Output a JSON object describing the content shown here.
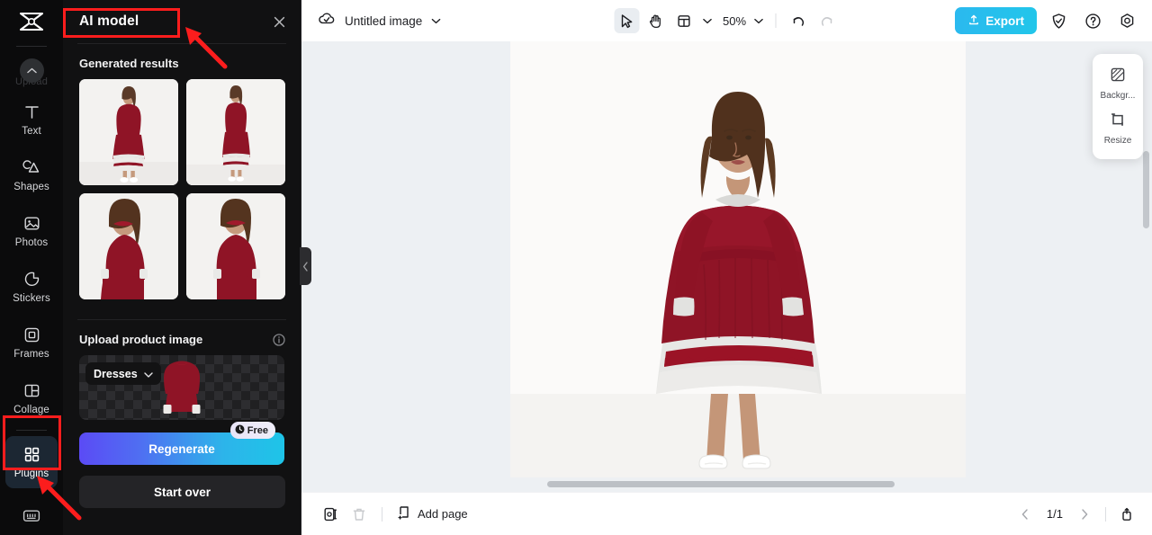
{
  "app": {
    "brand": "capcut-logo"
  },
  "rail": {
    "upload": {
      "label": "Upload",
      "icon": "chevron-up-icon"
    },
    "items": [
      {
        "label": "Text",
        "icon": "text-icon",
        "active": false
      },
      {
        "label": "Shapes",
        "icon": "shapes-icon",
        "active": false
      },
      {
        "label": "Photos",
        "icon": "photos-icon",
        "active": false
      },
      {
        "label": "Stickers",
        "icon": "stickers-icon",
        "active": false
      },
      {
        "label": "Frames",
        "icon": "frames-icon",
        "active": false
      },
      {
        "label": "Collage",
        "icon": "collage-icon",
        "active": false
      },
      {
        "label": "Plugins",
        "icon": "plugins-icon",
        "active": true
      }
    ],
    "bottom_icon": "keyboard-icon"
  },
  "panel": {
    "title": "AI model",
    "close_icon": "close-icon",
    "generated": {
      "heading": "Generated results",
      "thumbs": [
        {
          "alt": "full-body model red dress front"
        },
        {
          "alt": "full-body model red dress front alt"
        },
        {
          "alt": "half-body model red dress"
        },
        {
          "alt": "half-body model red dress alt"
        }
      ]
    },
    "upload_section": {
      "heading": "Upload product image",
      "info_icon": "info-icon",
      "category": "Dresses",
      "category_chevron": "chevron-down-icon"
    },
    "regenerate": {
      "label": "Regenerate",
      "badge": "Free",
      "badge_icon": "clock-icon"
    },
    "start_over": {
      "label": "Start over"
    },
    "collapse_icon": "chevron-left-icon"
  },
  "topbar": {
    "cloud_icon": "cloud-save-icon",
    "doc_name": "Untitled image",
    "doc_chevron": "chevron-down-icon",
    "tools": [
      {
        "name": "select-tool",
        "icon": "cursor-icon",
        "selected": true
      },
      {
        "name": "hand-tool",
        "icon": "hand-icon",
        "selected": false
      },
      {
        "name": "layout-tool",
        "icon": "layout-icon",
        "selected": false
      }
    ],
    "zoom": "50%",
    "zoom_chevron": "chevron-down-icon",
    "undo_icon": "undo-icon",
    "redo_icon": "redo-icon",
    "export": {
      "label": "Export",
      "icon": "upload-icon"
    },
    "shield_icon": "shield-check-icon",
    "help_icon": "help-icon",
    "settings_icon": "settings-gear-icon"
  },
  "float_panel": {
    "items": [
      {
        "label": "Backgr...",
        "icon": "background-icon"
      },
      {
        "label": "Resize",
        "icon": "resize-icon"
      }
    ]
  },
  "canvas": {
    "alt": "model in red velvet dress with white ruffle hem and white sneakers"
  },
  "bottombar": {
    "duplicate_icon": "duplicate-page-icon",
    "delete_icon": "trash-icon",
    "add_page": {
      "label": "Add page",
      "icon": "add-page-icon"
    },
    "prev_icon": "chevron-left-icon",
    "page_indicator": "1/1",
    "next_icon": "chevron-right-icon",
    "export_icon": "export-page-icon"
  },
  "annotations": {
    "title_box": "highlight-ai-model-title",
    "plugins_box": "highlight-plugins-item",
    "colors": {
      "marker": "#fc1d1d"
    }
  }
}
